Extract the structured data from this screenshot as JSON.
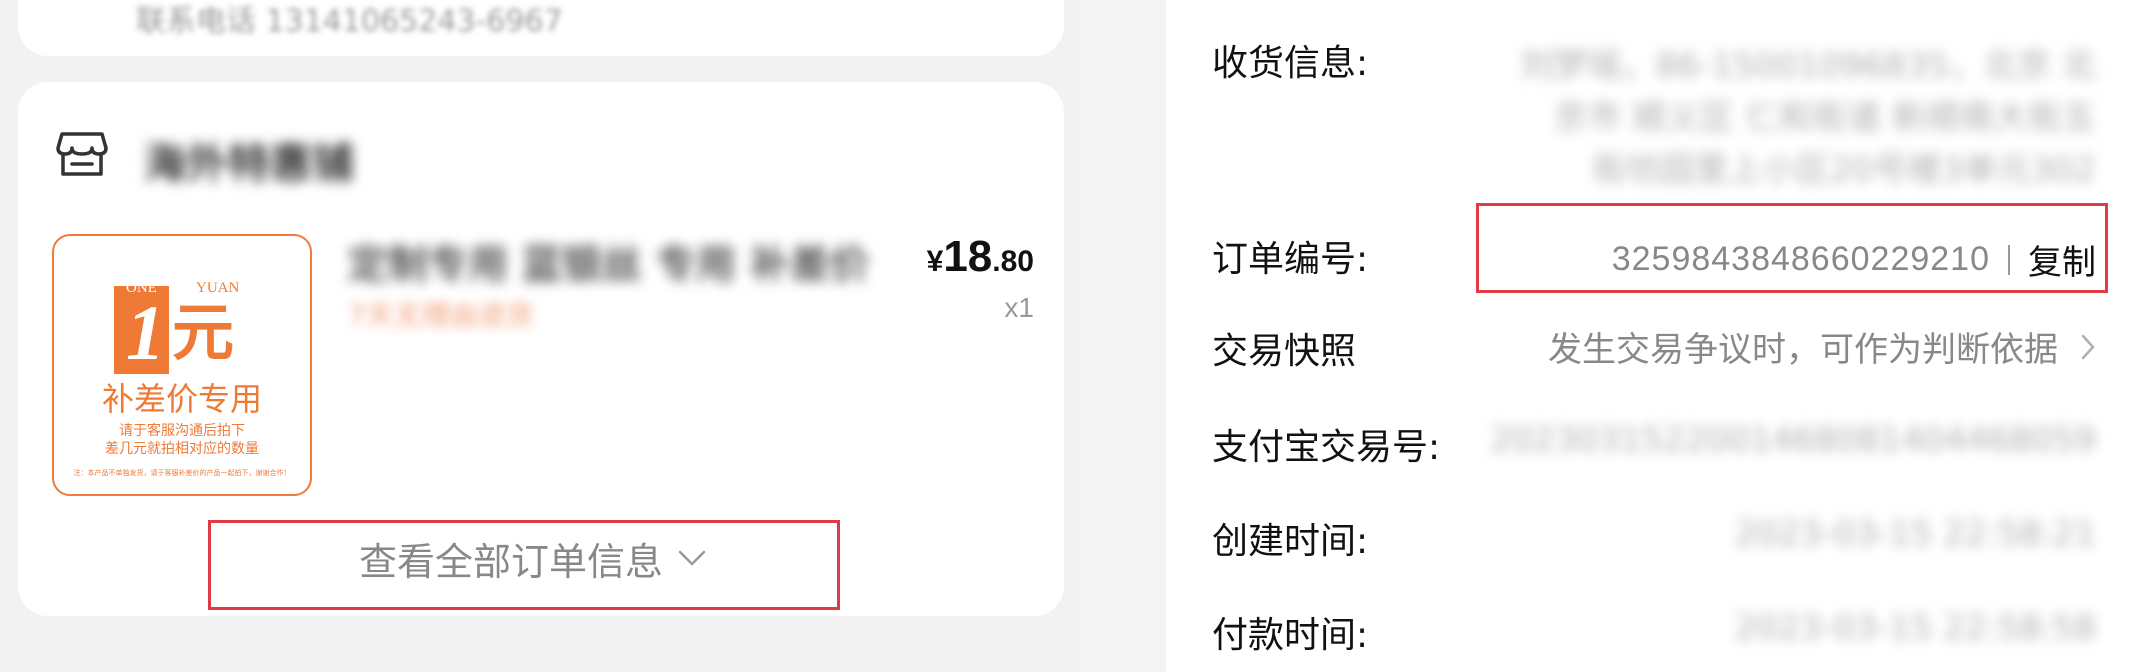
{
  "left": {
    "top_card": {
      "text": "联系电话 13141065243-6967"
    },
    "store": {
      "name": "海外特惠铺",
      "icon": "store-icon"
    },
    "product": {
      "image": {
        "one": "ONE",
        "yuan_en": "YUAN",
        "big_digit": "1",
        "yuan_cn": "元",
        "subtitle": "补差价专用",
        "note_1": "请于客服沟通后拍下",
        "note_2": "差几元就拍相对应的数量",
        "footnote": "注：本产品不单独发货，请于客服补差价的产品一起拍下，谢谢合作！"
      },
      "title": "定制专用 蓝银丝 专用 补差价",
      "tag": "7天无理由退货",
      "price": {
        "currency": "¥",
        "integer": "18",
        "decimal": ".80"
      },
      "quantity": "x1"
    },
    "view_all": {
      "label": "查看全部订单信息",
      "icon": "chevron-down-icon"
    },
    "highlight_color": "#e03a45"
  },
  "right": {
    "shipping": {
      "label": "收货信息:",
      "lines": [
        "刘梦瑶，86-15001096835，北京 北",
        "京市 顺义区 仁和街道 新顺南大街五",
        "街坊园里上小区20号楼3单元302"
      ]
    },
    "order_no": {
      "label": "订单编号:",
      "value": "3259843848660229210",
      "copy_label": "复制"
    },
    "snapshot": {
      "label": "交易快照",
      "value": "发生交易争议时，可作为判断依据",
      "icon": "chevron-right-icon"
    },
    "alipay": {
      "label": "支付宝交易号:",
      "value": "2023031522001468081404468059"
    },
    "created": {
      "label": "创建时间:",
      "value": "2023-03-15 22:58:21"
    },
    "paid": {
      "label": "付款时间:",
      "value": "2023-03-15 22:58:58"
    }
  }
}
